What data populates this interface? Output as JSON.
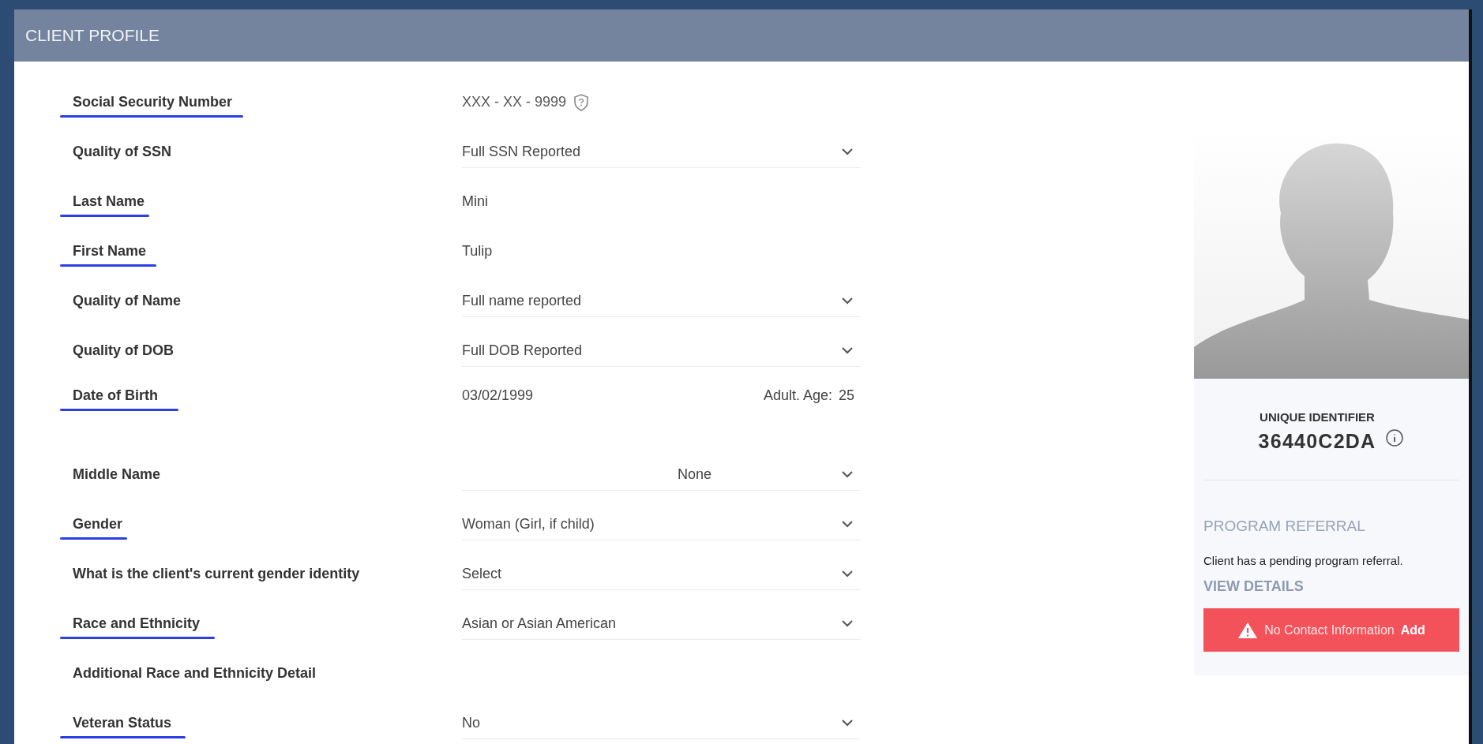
{
  "header": {
    "title": "CLIENT PROFILE"
  },
  "fields": [
    {
      "label": "Social Security Number",
      "kind": "ssn",
      "value": "XXX - XX - 9999",
      "underlined": true
    },
    {
      "label": "Quality of SSN",
      "kind": "select",
      "value": "Full SSN Reported",
      "underlined": false
    },
    {
      "label": "Last Name",
      "kind": "text",
      "value": "Mini",
      "underlined": true
    },
    {
      "label": "First Name",
      "kind": "text",
      "value": "Tulip",
      "underlined": true
    },
    {
      "label": "Quality of Name",
      "kind": "select",
      "value": "Full name reported",
      "underlined": false
    },
    {
      "label": "Quality of DOB",
      "kind": "select",
      "value": "Full DOB Reported",
      "underlined": false
    },
    {
      "label": "Date of Birth",
      "kind": "dob",
      "value": "03/02/1999",
      "age_label": "Adult. Age:",
      "age": "25",
      "underlined": true
    },
    {
      "label": "Middle Name",
      "kind": "select_centered",
      "value": "None",
      "underlined": false
    },
    {
      "label": "Gender",
      "kind": "select",
      "value": "Woman (Girl, if child)",
      "underlined": true
    },
    {
      "label": "What is the client's current gender identity",
      "kind": "select",
      "value": "Select",
      "underlined": false
    },
    {
      "label": "Race and Ethnicity",
      "kind": "select",
      "value": "Asian or Asian American",
      "underlined": true
    },
    {
      "label": "Additional Race and Ethnicity Detail",
      "kind": "label_only",
      "underlined": false
    },
    {
      "label": "Veteran Status",
      "kind": "select",
      "value": "No",
      "underlined": true
    }
  ],
  "profile": {
    "identifier_label": "UNIQUE IDENTIFIER",
    "identifier": "36440C2DA",
    "referral_title": "PROGRAM REFERRAL",
    "referral_text": "Client has a pending program referral.",
    "referral_link": "VIEW DETAILS",
    "alert_text": "No Contact Information",
    "alert_action": "Add"
  }
}
